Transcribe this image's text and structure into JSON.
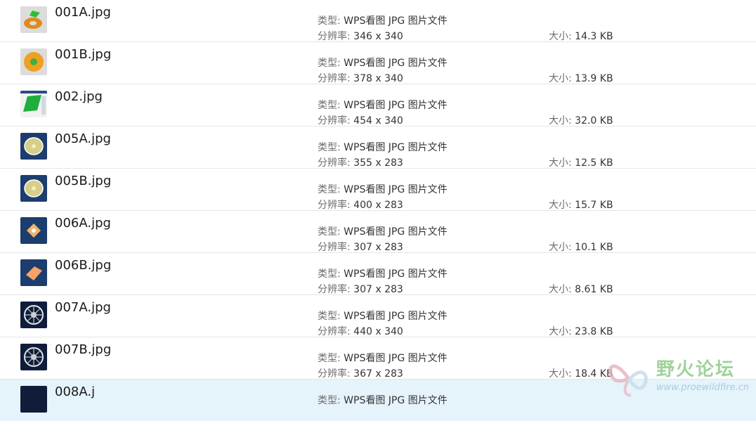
{
  "files": [
    {
      "name": "001A.jpg",
      "type_label": "类型:",
      "type_value": "WPS看图 JPG 图片文件",
      "res_label": "分辨率:",
      "res_value": "346 x 340",
      "size_label": "大小:",
      "size_value": "14.3 KB",
      "thumb_icon": "orange-ring-green-part-icon"
    },
    {
      "name": "001B.jpg",
      "type_label": "类型:",
      "type_value": "WPS看图 JPG 图片文件",
      "res_label": "分辨率:",
      "res_value": "378 x 340",
      "size_label": "大小:",
      "size_value": "13.9 KB",
      "thumb_icon": "orange-disc-green-center-icon"
    },
    {
      "name": "002.jpg",
      "type_label": "类型:",
      "type_value": "WPS看图 JPG 图片文件",
      "res_label": "分辨率:",
      "res_value": "454 x 340",
      "size_label": "大小:",
      "size_value": "32.0 KB",
      "thumb_icon": "cad-window-green-surface-icon"
    },
    {
      "name": "005A.jpg",
      "type_label": "类型:",
      "type_value": "WPS看图 JPG 图片文件",
      "res_label": "分辨率:",
      "res_value": "355 x 283",
      "size_label": "大小:",
      "size_value": "12.5 KB",
      "thumb_icon": "yellow-dish-blue-bg-icon"
    },
    {
      "name": "005B.jpg",
      "type_label": "类型:",
      "type_value": "WPS看图 JPG 图片文件",
      "res_label": "分辨率:",
      "res_value": "400 x 283",
      "size_label": "大小:",
      "size_value": "15.7 KB",
      "thumb_icon": "yellow-dish-blue-bg-icon"
    },
    {
      "name": "006A.jpg",
      "type_label": "类型:",
      "type_value": "WPS看图 JPG 图片文件",
      "res_label": "分辨率:",
      "res_value": "307 x 283",
      "size_label": "大小:",
      "size_value": "10.1 KB",
      "thumb_icon": "orange-diamond-blue-bg-icon"
    },
    {
      "name": "006B.jpg",
      "type_label": "类型:",
      "type_value": "WPS看图 JPG 图片文件",
      "res_label": "分辨率:",
      "res_value": "307 x 283",
      "size_label": "大小:",
      "size_value": "8.61 KB",
      "thumb_icon": "orange-plate-blue-bg-icon"
    },
    {
      "name": "007A.jpg",
      "type_label": "类型:",
      "type_value": "WPS看图 JPG 图片文件",
      "res_label": "分辨率:",
      "res_value": "440 x 340",
      "size_label": "大小:",
      "size_value": "23.8 KB",
      "thumb_icon": "white-wheel-dark-bg-icon"
    },
    {
      "name": "007B.jpg",
      "type_label": "类型:",
      "type_value": "WPS看图 JPG 图片文件",
      "res_label": "分辨率:",
      "res_value": "367 x 283",
      "size_label": "大小:",
      "size_value": "18.4 KB",
      "thumb_icon": "white-wheel-dark-bg-icon"
    },
    {
      "name": "008A.j",
      "type_label": "类型:",
      "type_value": "WPS看图 JPG 图片文件",
      "res_label": "",
      "res_value": "",
      "size_label": "",
      "size_value": "",
      "thumb_icon": "dark-thumbnail-icon",
      "selected": true
    }
  ],
  "watermark": {
    "title": "野火论坛",
    "url": "www.proewildfire.cn"
  },
  "colors": {
    "row_divider": "#e5e5e5",
    "selected_row_bg": "#e5f3fb",
    "label_gray": "#6d6d6d",
    "watermark_green": "#9fd39a",
    "watermark_blue": "#a9cce2"
  }
}
